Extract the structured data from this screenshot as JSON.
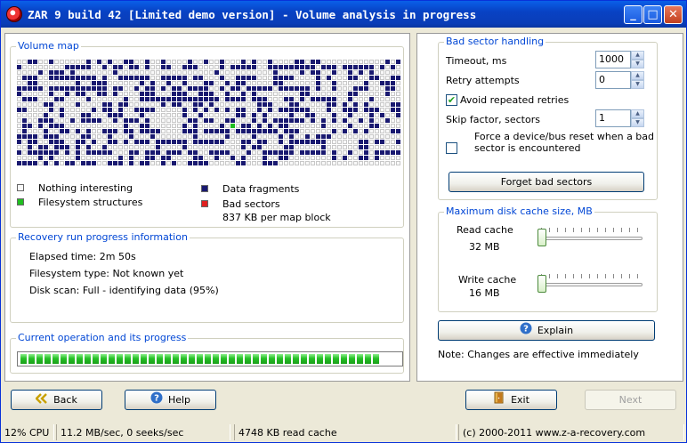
{
  "window": {
    "title": "ZAR 9 build 42 [Limited demo version] - Volume analysis in progress",
    "minimize_glyph": "_",
    "maximize_glyph": "□",
    "close_glyph": "✕"
  },
  "volume_map": {
    "legend": "Volume map",
    "legend_items": {
      "nothing": "Nothing interesting",
      "filesystem": "Filesystem structures",
      "data": "Data fragments",
      "bad": "Bad sectors"
    },
    "block_size": "837 KB per map block"
  },
  "recovery_info": {
    "legend": "Recovery run progress information",
    "elapsed": "Elapsed time: 2m 50s",
    "fs_type": "Filesystem type: Not known yet",
    "disk_scan": "Disk scan: Full - identifying data (95%)"
  },
  "current_op": {
    "legend": "Current operation and its progress",
    "progress_fraction": 0.95
  },
  "bad_sector": {
    "legend": "Bad sector handling",
    "timeout_label": "Timeout, ms",
    "timeout_value": "1000",
    "retry_label": "Retry attempts",
    "retry_value": "0",
    "avoid_label": "Avoid repeated retries",
    "avoid_checked": true,
    "skip_label": "Skip factor, sectors",
    "skip_value": "1",
    "reset_label_1": "Force a device/bus reset when a bad",
    "reset_label_2": "sector is encountered",
    "reset_checked": false,
    "forget_button": "Forget bad sectors"
  },
  "cache": {
    "legend": "Maximum disk cache size, MB",
    "read_label": "Read cache",
    "read_value": "32 MB",
    "read_level": 0.0,
    "write_label": "Write cache",
    "write_value": "16 MB",
    "write_level": 0.0,
    "explain_button": "Explain",
    "note": "Note: Changes are effective immediately"
  },
  "nav": {
    "back": "Back",
    "help": "Help",
    "exit": "Exit",
    "next": "Next"
  },
  "statusbar": {
    "cpu": "12% CPU",
    "speed": "11.2 MB/sec, 0 seeks/sec",
    "cache": "4748 KB read cache",
    "copyright": "(c) 2000-2011 www.z-a-recovery.com"
  },
  "colors": {
    "legend_blue": "#0046d5",
    "map_data": "#191970",
    "map_fs": "#1fbf1f",
    "map_bad": "#e02020",
    "map_empty": "#f8f8f8",
    "progress_green": "#26c026"
  },
  "icons": {
    "back": "double-chevron-left-icon",
    "help": "question-circle-icon",
    "exit": "door-exit-icon",
    "explain": "question-circle-icon"
  }
}
